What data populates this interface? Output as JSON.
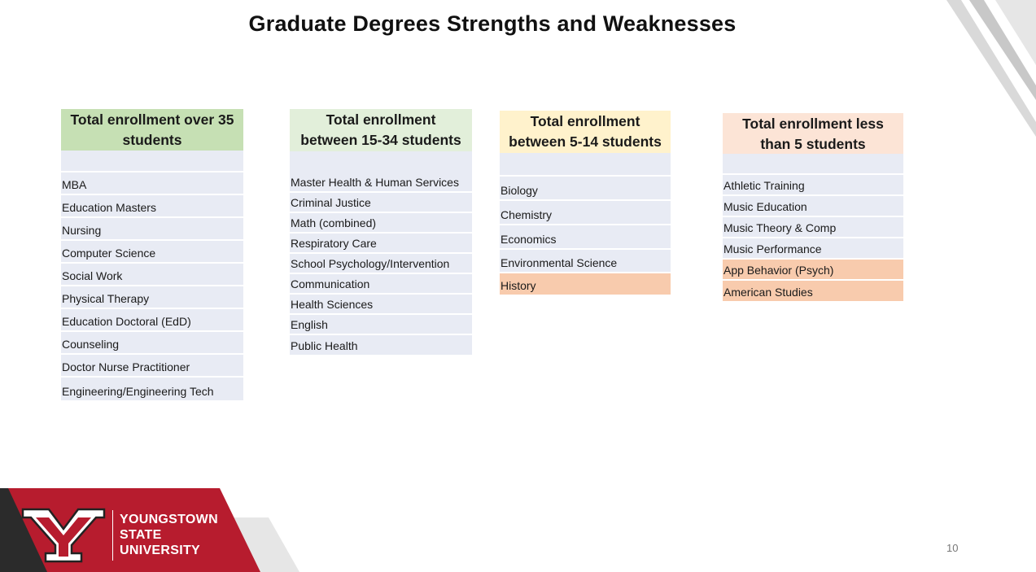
{
  "title": "Graduate Degrees Strengths and Weaknesses",
  "colors": {
    "green_header": "#c6e0b4",
    "light_green_header": "#e2efda",
    "yellow_header": "#fff2cc",
    "peach_header": "#fce4d6",
    "row": "#e8ebf4",
    "highlight_row": "#f8cbad",
    "brand_red": "#b71c2e"
  },
  "columns": [
    {
      "header": [
        "Total enrollment over 35",
        "students"
      ],
      "items": [
        "",
        "MBA",
        "Education Masters",
        "Nursing",
        "Computer Science",
        "Social Work",
        "Physical Therapy",
        "Education Doctoral (EdD)",
        "Counseling",
        "Doctor Nurse Practitioner",
        "Engineering/Engineering Tech"
      ]
    },
    {
      "header": [
        "Total enrollment",
        "between 15-34 students"
      ],
      "items": [
        "Master Health & Human Services",
        "Criminal Justice",
        "Math (combined)",
        "Respiratory Care",
        "School Psychology/Intervention",
        "Communication",
        "Health Sciences",
        "English",
        "Public Health"
      ]
    },
    {
      "header": [
        "Total enrollment",
        "between 5-14 students"
      ],
      "items": [
        "",
        "Biology",
        "Chemistry",
        "Economics",
        "Environmental Science",
        "History"
      ]
    },
    {
      "header": [
        "Total enrollment less",
        "than 5 students"
      ],
      "items": [
        "",
        "Athletic Training",
        "Music Education",
        "Music Theory & Comp",
        "Music Performance",
        "App Behavior (Psych)",
        "American Studies"
      ]
    }
  ],
  "logo": {
    "lines": [
      "YOUNGSTOWN",
      "STATE",
      "UNIVERSITY"
    ]
  },
  "page_number": "10"
}
